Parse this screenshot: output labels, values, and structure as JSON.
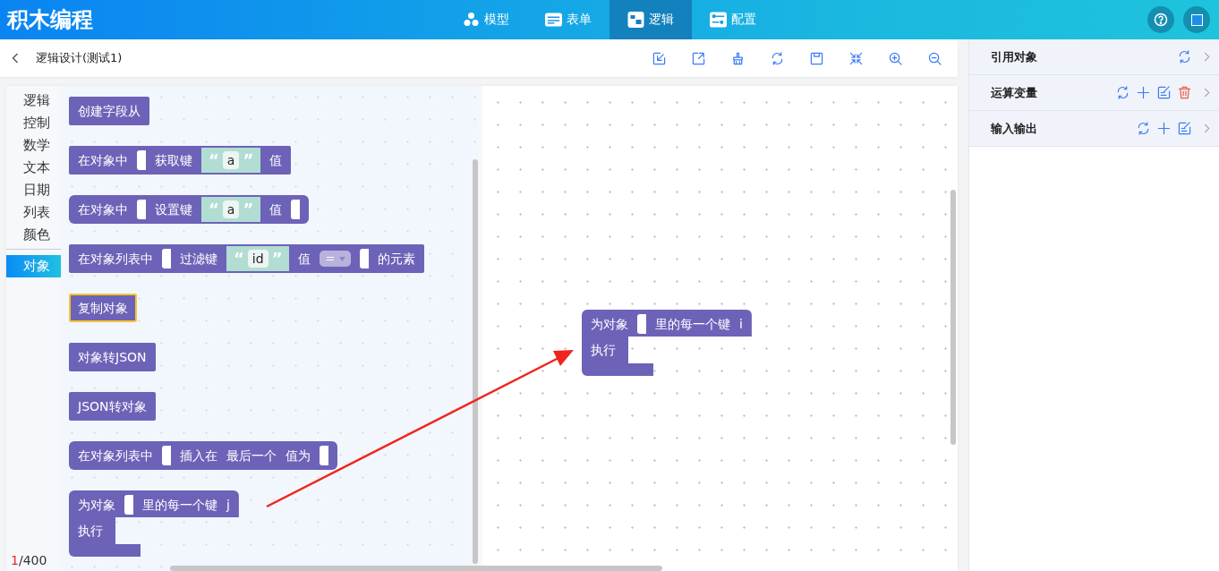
{
  "app_title": "积木编程",
  "nav_tabs": [
    {
      "label": "模型",
      "kind": "cubes",
      "selected": false
    },
    {
      "label": "表单",
      "kind": "form",
      "selected": false
    },
    {
      "label": "逻辑",
      "kind": "logic",
      "selected": true
    },
    {
      "label": "配置",
      "kind": "config",
      "selected": false
    }
  ],
  "header_buttons": [
    {
      "kind": "help"
    },
    {
      "kind": "square"
    }
  ],
  "page_title": "逻辑设计(测试1)",
  "toolbar": [
    {
      "kind": "import"
    },
    {
      "kind": "export"
    },
    {
      "kind": "clean"
    },
    {
      "kind": "refresh"
    },
    {
      "kind": "save"
    },
    {
      "kind": "collapse"
    },
    {
      "kind": "zoom-in"
    },
    {
      "kind": "zoom-out"
    }
  ],
  "categories": [
    {
      "label": "逻辑",
      "selected": false
    },
    {
      "label": "控制",
      "selected": false
    },
    {
      "label": "数学",
      "selected": false
    },
    {
      "label": "文本",
      "selected": false
    },
    {
      "label": "日期",
      "selected": false
    },
    {
      "label": "列表",
      "selected": false
    },
    {
      "label": "颜色",
      "selected": false
    },
    {
      "label": "对象",
      "selected": true
    }
  ],
  "counter": {
    "current": "1",
    "total": "/400"
  },
  "flyout_blocks": [
    {
      "kind": "value",
      "selected": false,
      "parts": [
        {
          "kind": "text",
          "text": "创建字段从"
        }
      ]
    },
    {
      "kind": "value",
      "selected": false,
      "parts": [
        {
          "kind": "text",
          "text": "在对象中"
        },
        {
          "kind": "socket"
        },
        {
          "kind": "text",
          "text": "获取键"
        },
        {
          "kind": "string",
          "open": "“",
          "value": "a",
          "close": "”"
        },
        {
          "kind": "text",
          "text": "值"
        }
      ]
    },
    {
      "kind": "chain",
      "selected": false,
      "parts": [
        {
          "kind": "text",
          "text": "在对象中"
        },
        {
          "kind": "socket"
        },
        {
          "kind": "text",
          "text": "设置键"
        },
        {
          "kind": "string",
          "open": "“",
          "value": "a",
          "close": "”"
        },
        {
          "kind": "text",
          "text": "值"
        },
        {
          "kind": "socket"
        }
      ]
    },
    {
      "kind": "value",
      "selected": false,
      "parts": [
        {
          "kind": "text",
          "text": "在对象列表中"
        },
        {
          "kind": "socket"
        },
        {
          "kind": "text",
          "text": "过滤键"
        },
        {
          "kind": "string",
          "open": "“",
          "value": "id",
          "close": "”"
        },
        {
          "kind": "text",
          "text": "值"
        },
        {
          "kind": "dropdown",
          "value": "="
        },
        {
          "kind": "socket"
        },
        {
          "kind": "text",
          "text": "的元素"
        }
      ]
    },
    {
      "kind": "value",
      "selected": true,
      "parts": [
        {
          "kind": "text",
          "text": "复制对象"
        }
      ]
    },
    {
      "kind": "value",
      "selected": false,
      "parts": [
        {
          "kind": "text",
          "text": "对象转JSON"
        }
      ]
    },
    {
      "kind": "value",
      "selected": false,
      "parts": [
        {
          "kind": "text",
          "text": "JSON转对象"
        }
      ]
    },
    {
      "kind": "chain",
      "selected": false,
      "parts": [
        {
          "kind": "text",
          "text": "在对象列表中"
        },
        {
          "kind": "socket"
        },
        {
          "kind": "text",
          "text": "插入在"
        },
        {
          "kind": "text",
          "text": "最后一个"
        },
        {
          "kind": "text",
          "text": "值为"
        },
        {
          "kind": "socket"
        }
      ]
    },
    {
      "kind": "statement",
      "selected": false,
      "do_label": "执行",
      "parts": [
        {
          "kind": "text",
          "text": "为对象"
        },
        {
          "kind": "socket"
        },
        {
          "kind": "text",
          "text": "里的每一个键"
        },
        {
          "kind": "text",
          "text": "j"
        }
      ]
    }
  ],
  "canvas_blocks": [
    {
      "kind": "statement",
      "selected": false,
      "do_label": "执行",
      "parts": [
        {
          "kind": "text",
          "text": "为对象"
        },
        {
          "kind": "socket"
        },
        {
          "kind": "text",
          "text": "里的每一个键"
        },
        {
          "kind": "text",
          "text": "i"
        }
      ]
    }
  ],
  "panel_sections": [
    {
      "title": "引用对象",
      "actions": [
        {
          "kind": "refresh"
        }
      ]
    },
    {
      "title": "运算变量",
      "actions": [
        {
          "kind": "refresh"
        },
        {
          "kind": "add"
        },
        {
          "kind": "edit"
        },
        {
          "kind": "delete"
        }
      ]
    },
    {
      "title": "输入输出",
      "actions": [
        {
          "kind": "refresh"
        },
        {
          "kind": "add"
        },
        {
          "kind": "edit"
        }
      ]
    }
  ]
}
